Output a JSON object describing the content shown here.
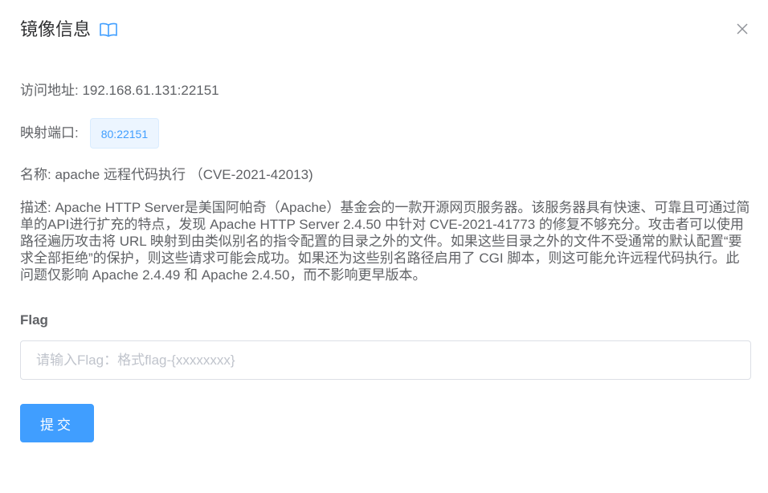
{
  "dialog": {
    "title": "镜像信息",
    "title_icon": "book-icon",
    "close_icon": "close-icon"
  },
  "info": {
    "address_label": "访问地址:",
    "address_value": "192.168.61.131:22151",
    "port_label": "映射端口:",
    "port_value": "80:22151",
    "name_label": "名称:",
    "name_value": "apache 远程代码执行 （CVE-2021-42013)",
    "desc_label": "描述:",
    "desc_value": "Apache HTTP Server是美国阿帕奇（Apache）基金会的一款开源网页服务器。该服务器具有快速、可靠且可通过简单的API进行扩充的特点，发现 Apache HTTP Server 2.4.50 中针对 CVE-2021-41773 的修复不够充分。攻击者可以使用路径遍历攻击将 URL 映射到由类似别名的指令配置的目录之外的文件。如果这些目录之外的文件不受通常的默认配置“要求全部拒绝”的保护，则这些请求可能会成功。如果还为这些别名路径启用了 CGI 脚本，则这可能允许远程代码执行。此问题仅影响 Apache 2.4.49 和 Apache 2.4.50，而不影响更早版本。"
  },
  "flag": {
    "label": "Flag",
    "value": "",
    "placeholder": "请输入Flag：格式flag-{xxxxxxxx}",
    "submit_label": "提交"
  },
  "colors": {
    "primary": "#409eff",
    "tag_bg": "#ecf5ff",
    "text": "#606266",
    "title": "#303133"
  }
}
